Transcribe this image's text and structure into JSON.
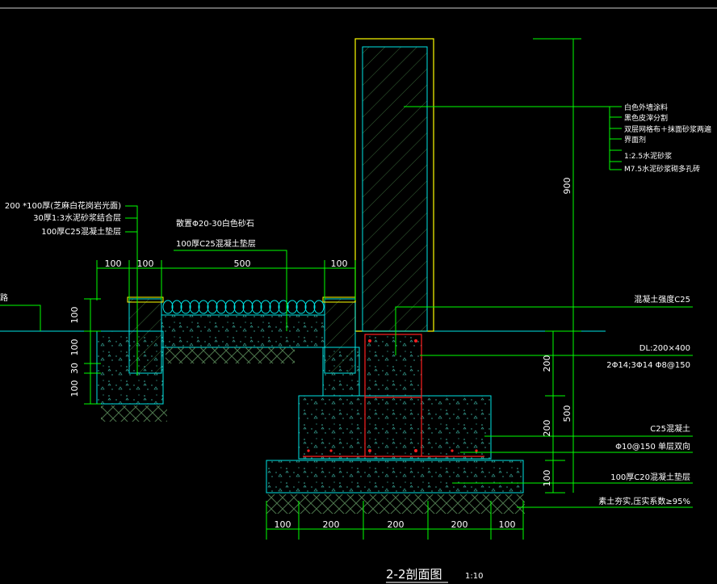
{
  "title": "2-2剖面图",
  "scale": "1:10",
  "colors": {
    "background": "#000000",
    "outline_cyan": "#00e5e5",
    "leader_green": "#00ff00",
    "wall_yellow": "#ffff00",
    "rebar_red": "#ff2020",
    "hatch_green": "#4a7a4a"
  },
  "left_labels": {
    "paving": "200 *100厚(芝麻白花岗岩光面)",
    "mortar": "30厚1:3水泥砂浆结合层",
    "cushion": "100厚C25混凝土垫层",
    "cut_text": "路"
  },
  "top_labels": {
    "pebble": "散置Φ20-30白色砂石",
    "concrete": "100厚C25混凝土垫层"
  },
  "right_labels": {
    "wall_layers": [
      "白色外墙涂料",
      "黑色皮滓分割",
      "双层网格布＋抹面砂浆两遍",
      "界面剂",
      "1:2.5水泥砂浆",
      "M7.5水泥砂浆砌多孔砖"
    ],
    "concrete_strength": "混凝土强度C25",
    "beam": "DL:200×400",
    "beam_rebar": "2Φ14;3Φ14  Φ8@150",
    "footing_concrete": "C25混凝土",
    "footing_rebar": "Φ10@150  单层双向",
    "footing_cushion": "100厚C20混凝土垫层",
    "soil": "素土夯实,压实系数≥95%"
  },
  "dims": {
    "top_row": [
      "100",
      "100",
      "500",
      "100"
    ],
    "bottom_row": [
      "100",
      "200",
      "200",
      "200",
      "100"
    ],
    "left_col": [
      "100",
      "100",
      "30",
      "100"
    ],
    "right_col_inner": [
      "200",
      "200",
      "100"
    ],
    "right_col_outer": [
      "900",
      "500"
    ]
  }
}
